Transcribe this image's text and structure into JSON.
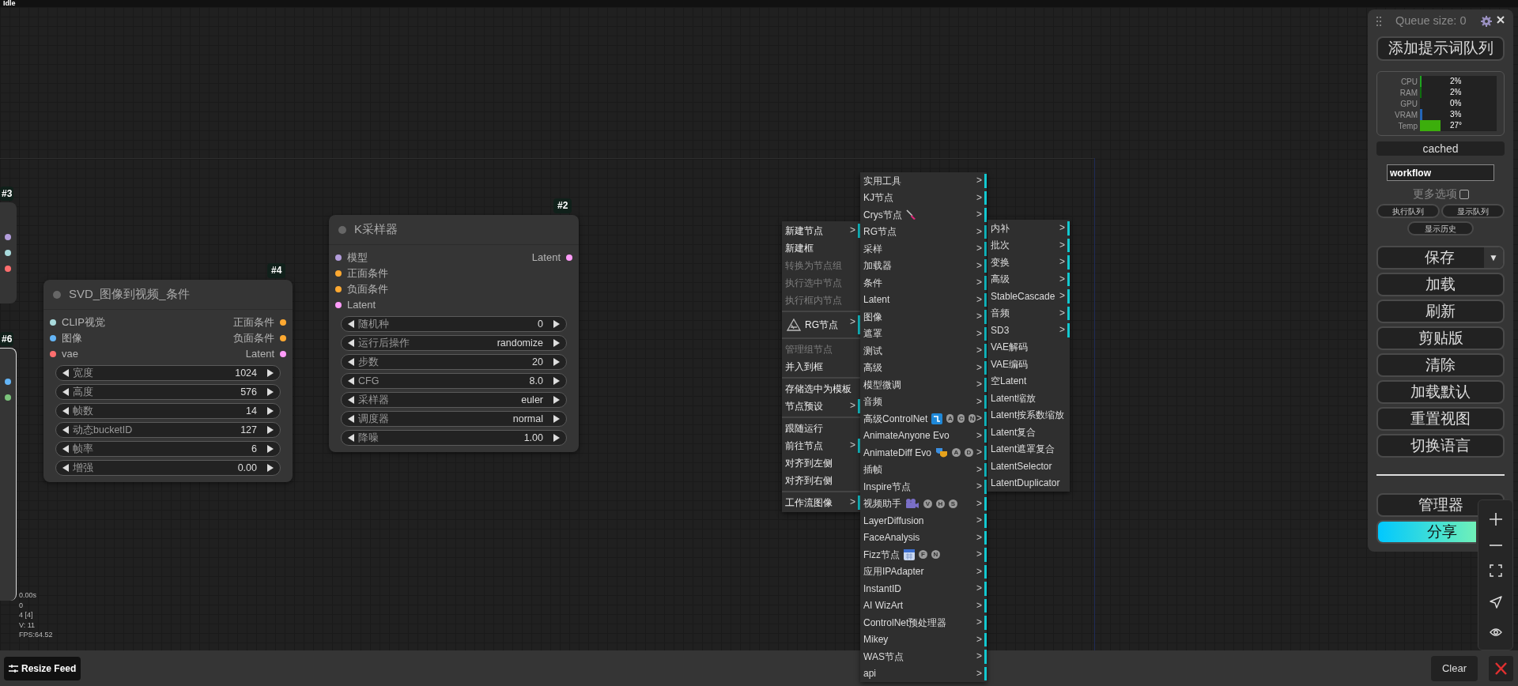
{
  "status": "Idle",
  "nodes": [
    {
      "badge": "#4",
      "title": "SVD_图像到视频_条件",
      "inputs": [
        {
          "label": "CLIP视觉",
          "color": "#a8dadc"
        },
        {
          "label": "图像",
          "color": "#64b5f6"
        },
        {
          "label": "vae",
          "color": "#ff6e6e"
        }
      ],
      "outputs": [
        {
          "label": "正面条件",
          "color": "#ffa931"
        },
        {
          "label": "负面条件",
          "color": "#ffa931"
        },
        {
          "label": "Latent",
          "color": "#ff9cf9"
        }
      ],
      "widgets": [
        {
          "label": "宽度",
          "value": "1024"
        },
        {
          "label": "高度",
          "value": "576"
        },
        {
          "label": "帧数",
          "value": "14"
        },
        {
          "label": "动态bucketID",
          "value": "127"
        },
        {
          "label": "帧率",
          "value": "6"
        },
        {
          "label": "增强",
          "value": "0.00"
        }
      ]
    },
    {
      "badge": "#2",
      "title": "K采样器",
      "inputs": [
        {
          "label": "模型",
          "color": "#b39ddb"
        },
        {
          "label": "正面条件",
          "color": "#ffa931"
        },
        {
          "label": "负面条件",
          "color": "#ffa931"
        },
        {
          "label": "Latent",
          "color": "#ff9cf9"
        }
      ],
      "outputs": [
        {
          "label": "Latent",
          "color": "#ff9cf9"
        }
      ],
      "widgets": [
        {
          "label": "随机种",
          "value": "0"
        },
        {
          "label": "运行后操作",
          "value": "randomize"
        },
        {
          "label": "步数",
          "value": "20"
        },
        {
          "label": "CFG",
          "value": "8.0"
        },
        {
          "label": "采样器",
          "value": "euler"
        },
        {
          "label": "调度器",
          "value": "normal"
        },
        {
          "label": "降噪",
          "value": "1.00"
        }
      ]
    }
  ],
  "partial_nodes": [
    {
      "badge": "#3",
      "slots": [
        {
          "color": "#b39ddb"
        },
        {
          "color": "#a8dadc"
        },
        {
          "color": "#ff6e6e"
        }
      ]
    },
    {
      "badge": "#6",
      "slots": [
        {
          "color": "#64b5f6"
        },
        {
          "color": "#7cc47c"
        }
      ]
    }
  ],
  "stats": [
    "0.00s",
    "0",
    "4 [4]",
    "V: 11",
    "FPS:64.52"
  ],
  "context_menu": {
    "groups": [
      [
        {
          "label": "新建节点",
          "arrow": ">",
          "disabled": false,
          "kind": "plain"
        },
        {
          "label": "新建框",
          "disabled": false,
          "kind": "plain"
        },
        {
          "label": "转换为节点组",
          "disabled": true,
          "kind": "plain"
        },
        {
          "label": "执行选中节点",
          "disabled": true,
          "kind": "plain"
        },
        {
          "label": "执行框内节点",
          "disabled": true,
          "kind": "plain"
        }
      ],
      [
        {
          "label": "RG节点",
          "arrow": ">",
          "disabled": false,
          "kind": "triangle"
        }
      ],
      [
        {
          "label": "管理组节点",
          "disabled": true,
          "kind": "plain"
        },
        {
          "label": "并入到框",
          "disabled": false,
          "kind": "plain"
        }
      ],
      [
        {
          "label": "存储选中为模板",
          "disabled": false,
          "kind": "plain"
        },
        {
          "label": "节点预设",
          "arrow": ">",
          "disabled": false,
          "kind": "plain"
        }
      ],
      [
        {
          "label": "跟随运行",
          "disabled": false,
          "kind": "plain"
        },
        {
          "label": "前往节点",
          "arrow": ">",
          "disabled": false,
          "kind": "plain"
        },
        {
          "label": "对齐到左侧",
          "disabled": false,
          "kind": "plain"
        },
        {
          "label": "对齐到右侧",
          "disabled": false,
          "kind": "plain"
        }
      ],
      [
        {
          "label": "工作流图像",
          "arrow": ">",
          "disabled": false,
          "kind": "plain"
        }
      ]
    ]
  },
  "submenu": {
    "items": [
      {
        "label": "实用工具",
        "arrow": ">",
        "kind": "plain"
      },
      {
        "label": "KJ节点",
        "arrow": ">",
        "kind": "plain"
      },
      {
        "label": "Crys节点",
        "arrow": ">",
        "kind": "brush"
      },
      {
        "label": "RG节点",
        "arrow": ">",
        "kind": "plain"
      },
      {
        "label": "采样",
        "arrow": ">",
        "kind": "plain"
      },
      {
        "label": "加载器",
        "arrow": ">",
        "kind": "plain"
      },
      {
        "label": "条件",
        "arrow": ">",
        "kind": "plain"
      },
      {
        "label": "Latent",
        "arrow": ">",
        "kind": "plain"
      },
      {
        "label": "图像",
        "arrow": ">",
        "kind": "plain"
      },
      {
        "label": "遮罩",
        "arrow": ">",
        "kind": "plain"
      },
      {
        "label": "测试",
        "arrow": ">",
        "kind": "plain"
      },
      {
        "label": "高级",
        "arrow": ">",
        "kind": "plain"
      },
      {
        "label": "模型微调",
        "arrow": ">",
        "kind": "plain"
      },
      {
        "label": "音频",
        "arrow": ">",
        "kind": "plain"
      },
      {
        "label": "高级ControlNet",
        "arrow": ">",
        "kind": "network",
        "badges": [
          "A",
          "C",
          "N"
        ]
      },
      {
        "label": "AnimateAnyone Evo",
        "arrow": ">",
        "kind": "plain"
      },
      {
        "label": "AnimateDiff Evo",
        "arrow": ">",
        "kind": "masks",
        "badges": [
          "A",
          "D"
        ]
      },
      {
        "label": "插帧",
        "arrow": ">",
        "kind": "plain"
      },
      {
        "label": "Inspire节点",
        "arrow": ">",
        "kind": "plain"
      },
      {
        "label": "视频助手",
        "arrow": ">",
        "kind": "camera",
        "badges": [
          "V",
          "H",
          "S"
        ]
      },
      {
        "label": "LayerDiffusion",
        "arrow": ">",
        "kind": "plain"
      },
      {
        "label": "FaceAnalysis",
        "arrow": ">",
        "kind": "plain"
      },
      {
        "label": "Fizz节点",
        "arrow": ">",
        "kind": "calendar",
        "badges": [
          "F",
          "N"
        ]
      },
      {
        "label": "应用IPAdapter",
        "arrow": ">",
        "kind": "plain"
      },
      {
        "label": "InstantID",
        "arrow": ">",
        "kind": "plain"
      },
      {
        "label": "AI WizArt",
        "arrow": ">",
        "kind": "plain"
      },
      {
        "label": "ControlNet预处理器",
        "arrow": ">",
        "kind": "plain"
      },
      {
        "label": "Mikey",
        "arrow": ">",
        "kind": "plain"
      },
      {
        "label": "WAS节点",
        "arrow": ">",
        "kind": "plain"
      },
      {
        "label": "api",
        "arrow": ">",
        "kind": "plain"
      }
    ]
  },
  "submenu_2": {
    "items": [
      {
        "label": "内补",
        "arrow": ">"
      },
      {
        "label": "批次",
        "arrow": ">"
      },
      {
        "label": "变换",
        "arrow": ">"
      },
      {
        "label": "高级",
        "arrow": ">"
      },
      {
        "label": "StableCascade",
        "arrow": ">"
      },
      {
        "label": "音频",
        "arrow": ">"
      },
      {
        "label": "SD3",
        "arrow": ">"
      },
      {
        "label": "VAE解码"
      },
      {
        "label": "VAE编码"
      },
      {
        "label": "空Latent"
      },
      {
        "label": "Latent缩放"
      },
      {
        "label": "Latent按系数缩放"
      },
      {
        "label": "Latent复合"
      },
      {
        "label": "Latent遮罩复合"
      },
      {
        "label": "LatentSelector"
      },
      {
        "label": "LatentDuplicator"
      }
    ]
  },
  "queue_panel": {
    "queue_label": "Queue size: 0",
    "queue_button": "添加提示词队列",
    "monitor": [
      {
        "label": "CPU",
        "reading": "2%",
        "level": 0.02,
        "color": "#1fa51f"
      },
      {
        "label": "RAM",
        "reading": "2%",
        "level": 0.02,
        "color": "#0e6e0e"
      },
      {
        "label": "GPU",
        "reading": "0%",
        "level": 0
      },
      {
        "label": "VRAM",
        "reading": "3%",
        "level": 0.03,
        "color": "#2466b8"
      },
      {
        "label": "Temp",
        "reading": "27°",
        "level": 0.27,
        "color": "#3cae0c"
      }
    ],
    "cache_status": "cached",
    "workflow_field": {
      "value": "workflow"
    },
    "more_options": {
      "label": "更多选项",
      "checked": false
    },
    "small_buttons": [
      "执行队列",
      "显示队列",
      "显示历史"
    ],
    "save_button": {
      "label": "保存",
      "dropdown": "▼"
    },
    "buttons": [
      "加载",
      "刷新",
      "剪贴版",
      "清除",
      "加载默认",
      "重置视图",
      "切换语言"
    ],
    "manager_button": "管理器",
    "share_button": "分享"
  },
  "bottom_bar": {
    "resize_button": "Resize Feed",
    "clear_button": "Clear"
  }
}
